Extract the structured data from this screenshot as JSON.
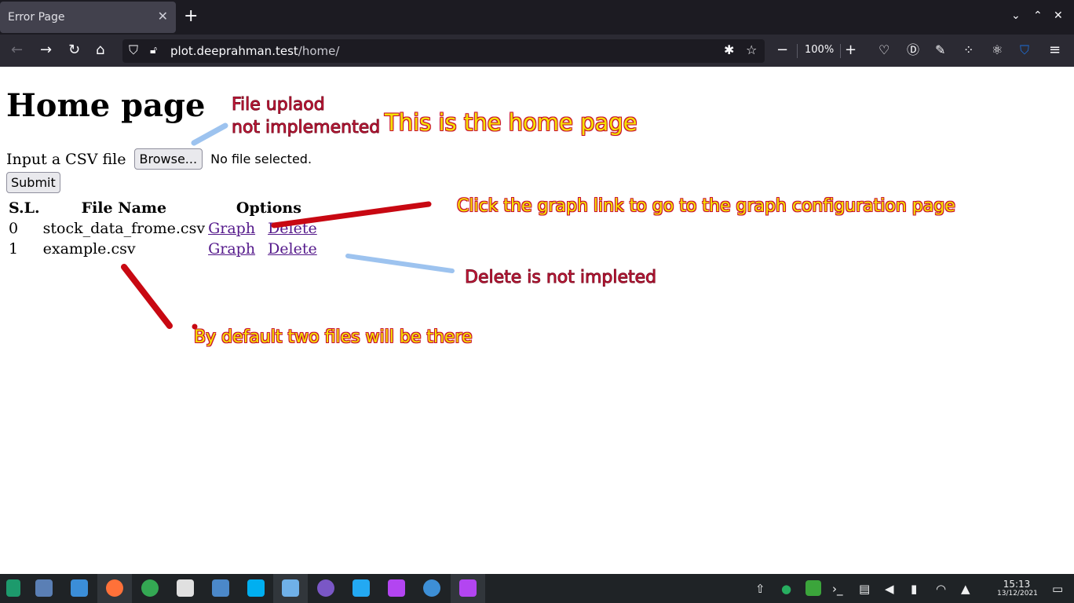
{
  "browser": {
    "tab_title": "Error Page",
    "url_host": "plot.deeprahman.test",
    "url_path": "/home/",
    "zoom": "100%"
  },
  "page": {
    "heading": "Home page",
    "input_label": "Input a CSV file",
    "browse_label": "Browse...",
    "no_file_label": "No file selected.",
    "submit_label": "Submit",
    "table": {
      "headers": [
        "S.L.",
        "File Name",
        "Options"
      ],
      "rows": [
        {
          "sl": "0",
          "file": "stock_data_frome.csv",
          "graph": "Graph",
          "delete": "Delete"
        },
        {
          "sl": "1",
          "file": "example.csv",
          "graph": "Graph",
          "delete": "Delete"
        }
      ]
    }
  },
  "annotations": {
    "upload_line1": "File uplaod",
    "upload_line2": "not implemented",
    "home_note": "This is the home page",
    "graph_note": "Click the graph link to go to the graph configuration page",
    "delete_note": "Delete is not impleted",
    "default_note": "By default two files will be there"
  },
  "taskbar": {
    "time": "15:13",
    "date": "13/12/2021"
  },
  "colors": {
    "annotation_yellow": "#f5e102",
    "annotation_red": "#d81b3f",
    "stroke_red": "#c80812",
    "stroke_blue": "#9dc3ef",
    "link_visited": "#551a8b"
  }
}
